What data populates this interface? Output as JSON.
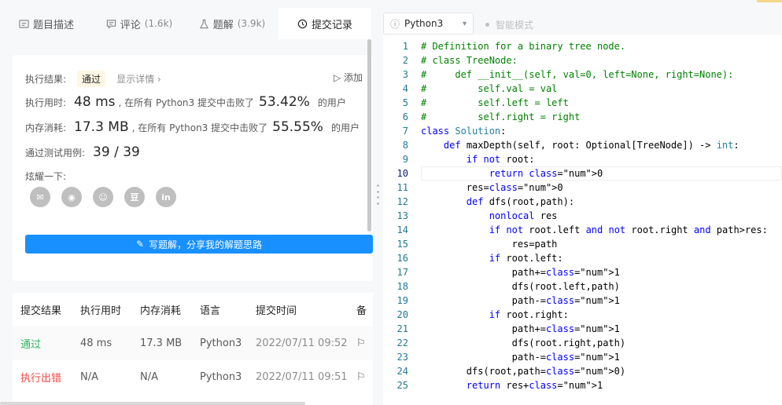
{
  "tabs": [
    {
      "label": "题目描述",
      "count": "",
      "icon": "description-icon"
    },
    {
      "label": "评论",
      "count": "(1.6k)",
      "icon": "comment-icon"
    },
    {
      "label": "题解",
      "count": "(3.9k)",
      "icon": "flask-icon"
    },
    {
      "label": "提交记录",
      "count": "",
      "icon": "clock-icon"
    }
  ],
  "result": {
    "exec_label": "执行结果:",
    "status": "通过",
    "detail_link": "显示详情 ›",
    "add_label": "▷ 添加",
    "time_label": "执行用时:",
    "time_value": "48 ms",
    "time_text": ", 在所有 Python3 提交中击败了",
    "time_pct": "53.42%",
    "users": "的用户",
    "mem_label": "内存消耗:",
    "mem_value": "17.3 MB",
    "mem_text": ", 在所有 Python3 提交中击败了",
    "mem_pct": "55.55%",
    "cases_label": "通过测试用例:",
    "cases_value": "39 / 39",
    "share_label": "炫耀一下:",
    "write_button": "写题解，分享我的解题思路"
  },
  "share_icons": [
    {
      "name": "wechat-icon",
      "glyph": "✉"
    },
    {
      "name": "weibo-icon",
      "glyph": "◉"
    },
    {
      "name": "qq-icon",
      "glyph": "☺"
    },
    {
      "name": "douban-icon",
      "glyph": "豆"
    },
    {
      "name": "linkedin-icon",
      "glyph": "in"
    }
  ],
  "submissions": {
    "headers": [
      "提交结果",
      "执行用时",
      "内存消耗",
      "语言",
      "提交时间",
      "备"
    ],
    "rows": [
      {
        "status": "通过",
        "time": "48 ms",
        "memory": "17.3 MB",
        "lang": "Python3",
        "submitted": "2022/07/11 09:52",
        "note": "⚐"
      },
      {
        "status": "执行出错",
        "time": "N/A",
        "memory": "N/A",
        "lang": "Python3",
        "submitted": "2022/07/11 09:51",
        "note": "⚐"
      }
    ]
  },
  "editor": {
    "language": "Python3",
    "smart_mode": "智能模式",
    "current_line": 10,
    "lines": [
      "# Definition for a binary tree node.",
      "# class TreeNode:",
      "#     def __init__(self, val=0, left=None, right=None):",
      "#         self.val = val",
      "#         self.left = left",
      "#         self.right = right",
      "class Solution:",
      "    def maxDepth(self, root: Optional[TreeNode]) -> int:",
      "        if not root:",
      "            return 0",
      "        res=0",
      "        def dfs(root,path):",
      "            nonlocal res",
      "            if not root.left and not root.right and path>res:",
      "                res=path",
      "            if root.left:",
      "                path+=1",
      "                dfs(root.left,path)",
      "                path-=1",
      "            if root.right:",
      "                path+=1",
      "                dfs(root.right,path)",
      "                path-=1",
      "        dfs(root,path=0)",
      "        return res+1"
    ]
  },
  "colors": {
    "accent": "#1890ff",
    "success": "#2db55d",
    "error": "#ef4743"
  }
}
